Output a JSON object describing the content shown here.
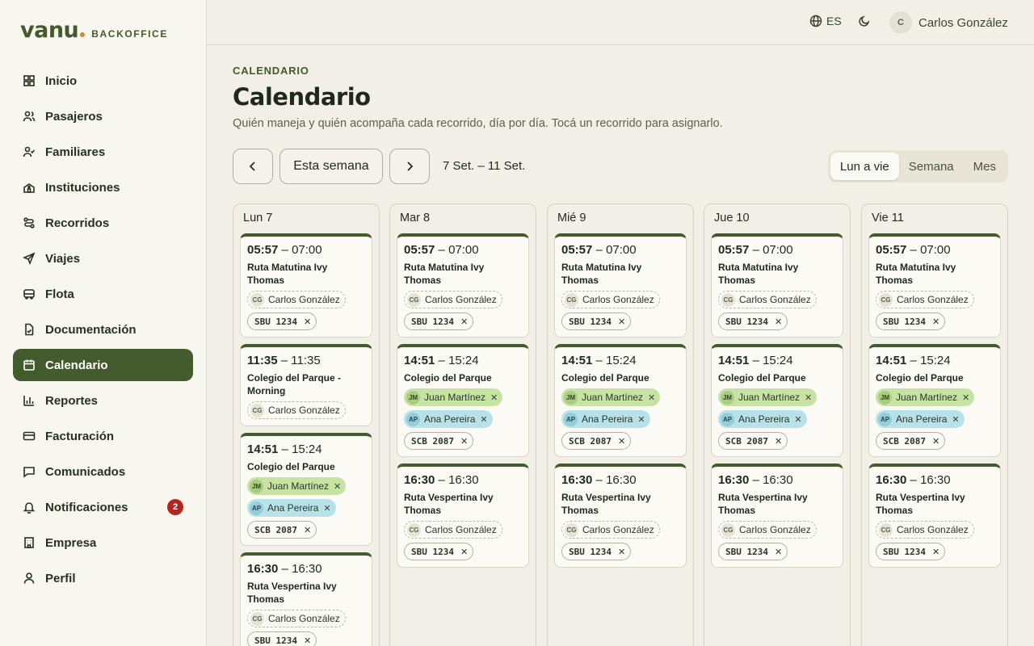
{
  "brand": {
    "word": "vanu",
    "sub": "BACKOFFICE"
  },
  "nav": [
    {
      "label": "Inicio",
      "icon": "grid-icon"
    },
    {
      "label": "Pasajeros",
      "icon": "users-icon"
    },
    {
      "label": "Familiares",
      "icon": "user-check-icon"
    },
    {
      "label": "Instituciones",
      "icon": "school-icon"
    },
    {
      "label": "Recorridos",
      "icon": "route-icon"
    },
    {
      "label": "Viajes",
      "icon": "send-icon"
    },
    {
      "label": "Flota",
      "icon": "bus-icon"
    },
    {
      "label": "Documentación",
      "icon": "file-check-icon"
    },
    {
      "label": "Calendario",
      "icon": "calendar-icon",
      "active": true
    },
    {
      "label": "Reportes",
      "icon": "bar-chart-icon"
    },
    {
      "label": "Facturación",
      "icon": "credit-card-icon"
    },
    {
      "label": "Comunicados",
      "icon": "message-icon"
    },
    {
      "label": "Notificaciones",
      "icon": "bell-icon",
      "badge": "2"
    },
    {
      "label": "Empresa",
      "icon": "building-icon"
    },
    {
      "label": "Perfil",
      "icon": "user-icon"
    }
  ],
  "header": {
    "lang": "ES",
    "user_initial": "C",
    "user_name": "Carlos González"
  },
  "page": {
    "eyebrow": "CALENDARIO",
    "title": "Calendario",
    "subtitle": "Quién maneja y quién acompaña cada recorrido, día por día. Tocá un recorrido para asignarlo."
  },
  "toolbar": {
    "today": "Esta semana",
    "range": "7 Set. – 11 Set.",
    "views": [
      "Lun a vie",
      "Semana",
      "Mes"
    ],
    "active_view": "Lun a vie"
  },
  "days": [
    {
      "label": "Lun 7",
      "trips": [
        {
          "start": "05:57",
          "end": "07:00",
          "name": "Ruta Matutina Ivy Thomas",
          "people": [
            {
              "type": "driver-empty",
              "initials": "CG",
              "name": "Carlos González",
              "removable": false
            }
          ],
          "plate": "SBU 1234"
        },
        {
          "start": "11:35",
          "end": "11:35",
          "name": "Colegio del Parque - Morning",
          "people": [
            {
              "type": "driver-empty",
              "initials": "CG",
              "name": "Carlos González",
              "removable": false
            }
          ],
          "plate": null
        },
        {
          "start": "14:51",
          "end": "15:24",
          "name": "Colegio del Parque",
          "people": [
            {
              "type": "driver",
              "initials": "JM",
              "name": "Juan Martínez",
              "removable": true
            },
            {
              "type": "aide",
              "initials": "AP",
              "name": "Ana Pereira",
              "removable": true
            }
          ],
          "plate": "SCB 2087"
        },
        {
          "start": "16:30",
          "end": "16:30",
          "name": "Ruta Vespertina Ivy Thomas",
          "people": [
            {
              "type": "driver-empty",
              "initials": "CG",
              "name": "Carlos González",
              "removable": false
            }
          ],
          "plate": "SBU 1234"
        }
      ]
    },
    {
      "label": "Mar 8",
      "trips": [
        {
          "start": "05:57",
          "end": "07:00",
          "name": "Ruta Matutina Ivy Thomas",
          "people": [
            {
              "type": "driver-empty",
              "initials": "CG",
              "name": "Carlos González",
              "removable": false
            }
          ],
          "plate": "SBU 1234"
        },
        {
          "start": "14:51",
          "end": "15:24",
          "name": "Colegio del Parque",
          "people": [
            {
              "type": "driver",
              "initials": "JM",
              "name": "Juan Martínez",
              "removable": true
            },
            {
              "type": "aide",
              "initials": "AP",
              "name": "Ana Pereira",
              "removable": true
            }
          ],
          "plate": "SCB 2087"
        },
        {
          "start": "16:30",
          "end": "16:30",
          "name": "Ruta Vespertina Ivy Thomas",
          "people": [
            {
              "type": "driver-empty",
              "initials": "CG",
              "name": "Carlos González",
              "removable": false
            }
          ],
          "plate": "SBU 1234"
        }
      ]
    },
    {
      "label": "Mié 9",
      "trips": [
        {
          "start": "05:57",
          "end": "07:00",
          "name": "Ruta Matutina Ivy Thomas",
          "people": [
            {
              "type": "driver-empty",
              "initials": "CG",
              "name": "Carlos González",
              "removable": false
            }
          ],
          "plate": "SBU 1234"
        },
        {
          "start": "14:51",
          "end": "15:24",
          "name": "Colegio del Parque",
          "people": [
            {
              "type": "driver",
              "initials": "JM",
              "name": "Juan Martínez",
              "removable": true
            },
            {
              "type": "aide",
              "initials": "AP",
              "name": "Ana Pereira",
              "removable": true
            }
          ],
          "plate": "SCB 2087"
        },
        {
          "start": "16:30",
          "end": "16:30",
          "name": "Ruta Vespertina Ivy Thomas",
          "people": [
            {
              "type": "driver-empty",
              "initials": "CG",
              "name": "Carlos González",
              "removable": false
            }
          ],
          "plate": "SBU 1234"
        }
      ]
    },
    {
      "label": "Jue 10",
      "trips": [
        {
          "start": "05:57",
          "end": "07:00",
          "name": "Ruta Matutina Ivy Thomas",
          "people": [
            {
              "type": "driver-empty",
              "initials": "CG",
              "name": "Carlos González",
              "removable": false
            }
          ],
          "plate": "SBU 1234"
        },
        {
          "start": "14:51",
          "end": "15:24",
          "name": "Colegio del Parque",
          "people": [
            {
              "type": "driver",
              "initials": "JM",
              "name": "Juan Martínez",
              "removable": true
            },
            {
              "type": "aide",
              "initials": "AP",
              "name": "Ana Pereira",
              "removable": true
            }
          ],
          "plate": "SCB 2087"
        },
        {
          "start": "16:30",
          "end": "16:30",
          "name": "Ruta Vespertina Ivy Thomas",
          "people": [
            {
              "type": "driver-empty",
              "initials": "CG",
              "name": "Carlos González",
              "removable": false
            }
          ],
          "plate": "SBU 1234"
        }
      ]
    },
    {
      "label": "Vie 11",
      "trips": [
        {
          "start": "05:57",
          "end": "07:00",
          "name": "Ruta Matutina Ivy Thomas",
          "people": [
            {
              "type": "driver-empty",
              "initials": "CG",
              "name": "Carlos González",
              "removable": false
            }
          ],
          "plate": "SBU 1234"
        },
        {
          "start": "14:51",
          "end": "15:24",
          "name": "Colegio del Parque",
          "people": [
            {
              "type": "driver",
              "initials": "JM",
              "name": "Juan Martínez",
              "removable": true
            },
            {
              "type": "aide",
              "initials": "AP",
              "name": "Ana Pereira",
              "removable": true
            }
          ],
          "plate": "SCB 2087"
        },
        {
          "start": "16:30",
          "end": "16:30",
          "name": "Ruta Vespertina Ivy Thomas",
          "people": [
            {
              "type": "driver-empty",
              "initials": "CG",
              "name": "Carlos González",
              "removable": false
            }
          ],
          "plate": "SBU 1234"
        }
      ]
    }
  ],
  "colors": {
    "brand": "#445b2d",
    "accent_dot": "#c9893a",
    "badge": "#b3261e",
    "driver_chip": "#c6e3a3",
    "aide_chip": "#b8e2e9"
  }
}
